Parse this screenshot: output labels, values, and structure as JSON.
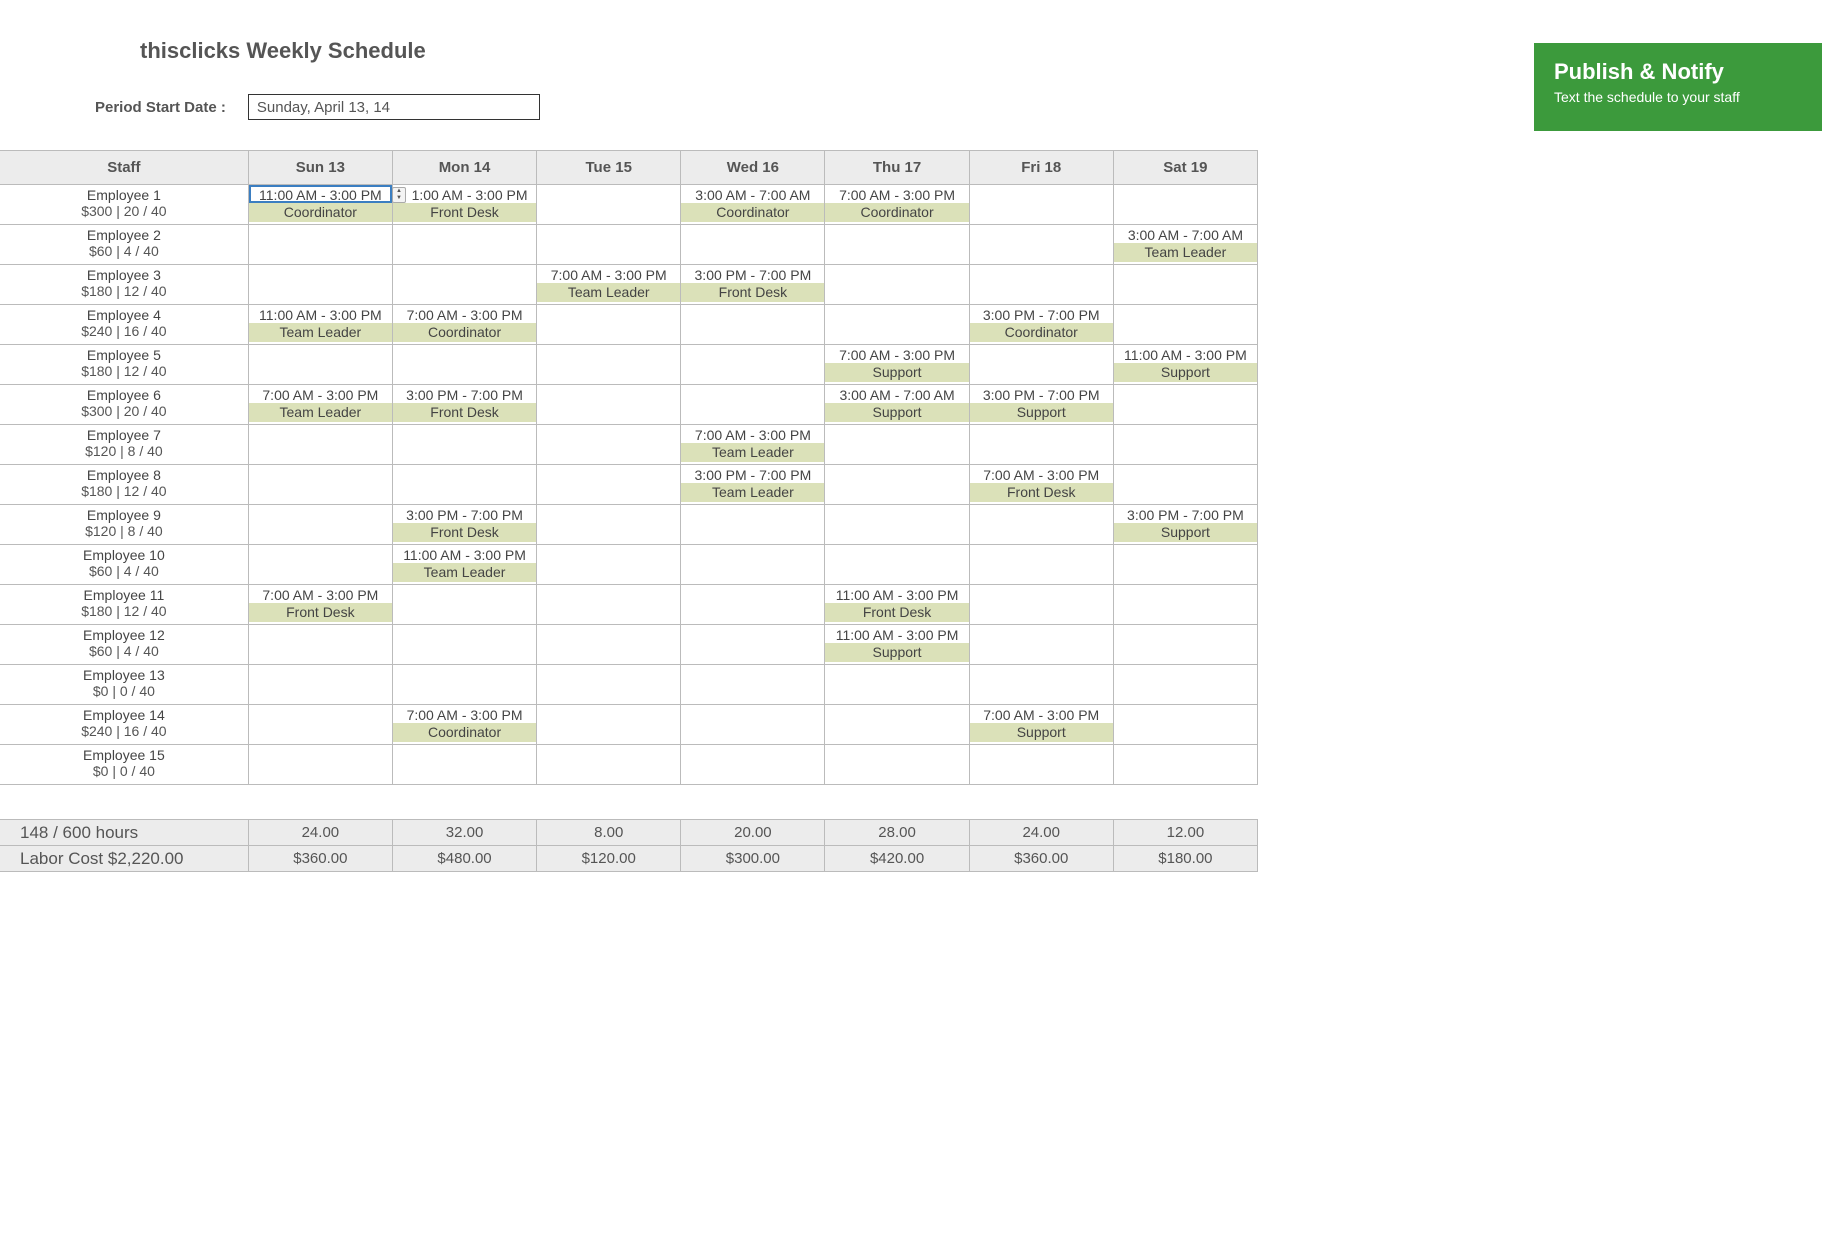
{
  "header": {
    "title": "thisclicks Weekly Schedule",
    "period_label": "Period Start Date :",
    "period_value": "Sunday, April 13, 14",
    "publish_title": "Publish & Notify",
    "publish_sub": "Text the schedule to your staff"
  },
  "columns": {
    "staff": "Staff",
    "days": [
      "Sun 13",
      "Mon 14",
      "Tue 15",
      "Wed 16",
      "Thu 17",
      "Fri 18",
      "Sat 19"
    ]
  },
  "employees": [
    {
      "name": "Employee 1",
      "stats": "$300 | 20 / 40",
      "shifts": [
        {
          "time": "11:00 AM - 3:00 PM",
          "role": "Coordinator"
        },
        {
          "time": "1:00 AM - 3:00 PM",
          "role": "Front Desk"
        },
        null,
        {
          "time": "3:00 AM - 7:00 AM",
          "role": "Coordinator"
        },
        {
          "time": "7:00 AM - 3:00 PM",
          "role": "Coordinator"
        },
        null,
        null
      ]
    },
    {
      "name": "Employee 2",
      "stats": "$60 | 4 / 40",
      "shifts": [
        null,
        null,
        null,
        null,
        null,
        null,
        {
          "time": "3:00 AM - 7:00 AM",
          "role": "Team Leader"
        }
      ]
    },
    {
      "name": "Employee 3",
      "stats": "$180 | 12 / 40",
      "shifts": [
        null,
        null,
        {
          "time": "7:00 AM - 3:00 PM",
          "role": "Team Leader"
        },
        {
          "time": "3:00 PM - 7:00 PM",
          "role": "Front Desk"
        },
        null,
        null,
        null
      ]
    },
    {
      "name": "Employee 4",
      "stats": "$240 | 16 / 40",
      "shifts": [
        {
          "time": "11:00 AM - 3:00 PM",
          "role": "Team Leader"
        },
        {
          "time": "7:00 AM - 3:00 PM",
          "role": "Coordinator"
        },
        null,
        null,
        null,
        {
          "time": "3:00 PM - 7:00 PM",
          "role": "Coordinator"
        },
        null
      ]
    },
    {
      "name": "Employee 5",
      "stats": "$180 | 12 / 40",
      "shifts": [
        null,
        null,
        null,
        null,
        {
          "time": "7:00 AM - 3:00 PM",
          "role": "Support"
        },
        null,
        {
          "time": "11:00 AM - 3:00 PM",
          "role": "Support"
        }
      ]
    },
    {
      "name": "Employee 6",
      "stats": "$300 | 20 / 40",
      "shifts": [
        {
          "time": "7:00 AM - 3:00 PM",
          "role": "Team Leader"
        },
        {
          "time": "3:00 PM - 7:00 PM",
          "role": "Front Desk"
        },
        null,
        null,
        {
          "time": "3:00 AM - 7:00 AM",
          "role": "Support"
        },
        {
          "time": "3:00 PM - 7:00 PM",
          "role": "Support"
        },
        null
      ]
    },
    {
      "name": "Employee 7",
      "stats": "$120 | 8 / 40",
      "shifts": [
        null,
        null,
        null,
        {
          "time": "7:00 AM - 3:00 PM",
          "role": "Team Leader"
        },
        null,
        null,
        null
      ]
    },
    {
      "name": "Employee 8",
      "stats": "$180 | 12 / 40",
      "shifts": [
        null,
        null,
        null,
        {
          "time": "3:00 PM - 7:00 PM",
          "role": "Team Leader"
        },
        null,
        {
          "time": "7:00 AM - 3:00 PM",
          "role": "Front Desk"
        },
        null
      ]
    },
    {
      "name": "Employee 9",
      "stats": "$120 | 8 / 40",
      "shifts": [
        null,
        {
          "time": "3:00 PM - 7:00 PM",
          "role": "Front Desk"
        },
        null,
        null,
        null,
        null,
        {
          "time": "3:00 PM - 7:00 PM",
          "role": "Support"
        }
      ]
    },
    {
      "name": "Employee 10",
      "stats": "$60 | 4 / 40",
      "shifts": [
        null,
        {
          "time": "11:00 AM - 3:00 PM",
          "role": "Team Leader"
        },
        null,
        null,
        null,
        null,
        null
      ]
    },
    {
      "name": "Employee 11",
      "stats": "$180 | 12 / 40",
      "shifts": [
        {
          "time": "7:00 AM - 3:00 PM",
          "role": "Front Desk"
        },
        null,
        null,
        null,
        {
          "time": "11:00 AM - 3:00 PM",
          "role": "Front Desk"
        },
        null,
        null
      ]
    },
    {
      "name": "Employee 12",
      "stats": "$60 | 4 / 40",
      "shifts": [
        null,
        null,
        null,
        null,
        {
          "time": "11:00 AM - 3:00 PM",
          "role": "Support"
        },
        null,
        null
      ]
    },
    {
      "name": "Employee 13",
      "stats": "$0 | 0 / 40",
      "shifts": [
        null,
        null,
        null,
        null,
        null,
        null,
        null
      ]
    },
    {
      "name": "Employee 14",
      "stats": "$240 | 16 / 40",
      "shifts": [
        null,
        {
          "time": "7:00 AM - 3:00 PM",
          "role": "Coordinator"
        },
        null,
        null,
        null,
        {
          "time": "7:00 AM - 3:00 PM",
          "role": "Support"
        },
        null
      ]
    },
    {
      "name": "Employee 15",
      "stats": "$0 | 0 / 40",
      "shifts": [
        null,
        null,
        null,
        null,
        null,
        null,
        null
      ]
    }
  ],
  "summary": {
    "hours_label": "148 / 600 hours",
    "hours": [
      "24.00",
      "32.00",
      "8.00",
      "20.00",
      "28.00",
      "24.00",
      "12.00"
    ],
    "cost_label": "Labor Cost $2,220.00",
    "costs": [
      "$360.00",
      "$480.00",
      "$120.00",
      "$300.00",
      "$420.00",
      "$360.00",
      "$180.00"
    ]
  },
  "selected_cell": {
    "row": 0,
    "col": 0
  },
  "stepper_cell": {
    "row": 0,
    "col": 1
  }
}
